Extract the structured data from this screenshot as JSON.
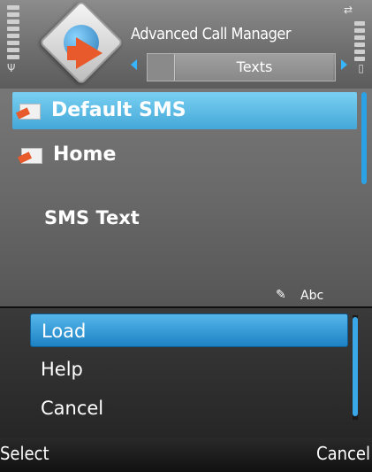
{
  "header": {
    "app_title": "Advanced Call Manager",
    "tab_label": "Texts",
    "icons": [
      "signal-strength-icon",
      "battery-icon",
      "usb-icon",
      "antenna-icon",
      "lock-icon",
      "app-icon"
    ]
  },
  "list": {
    "items": [
      {
        "label": "Default SMS",
        "icon": "sms-envelope-icon",
        "selected": true
      },
      {
        "label": "Home",
        "icon": "sms-envelope-icon",
        "selected": false
      }
    ]
  },
  "editor": {
    "title": "SMS Text",
    "input_mode": "Abc"
  },
  "menu": {
    "items": [
      {
        "label": "Load",
        "selected": true
      },
      {
        "label": "Help",
        "selected": false
      },
      {
        "label": "Cancel",
        "selected": false
      }
    ]
  },
  "softkeys": {
    "left": "Select",
    "right": "Cancel"
  },
  "colors": {
    "accent": "#2ba2e6",
    "selection": "#56b6ea",
    "brand_arrow": "#e85a2b"
  }
}
